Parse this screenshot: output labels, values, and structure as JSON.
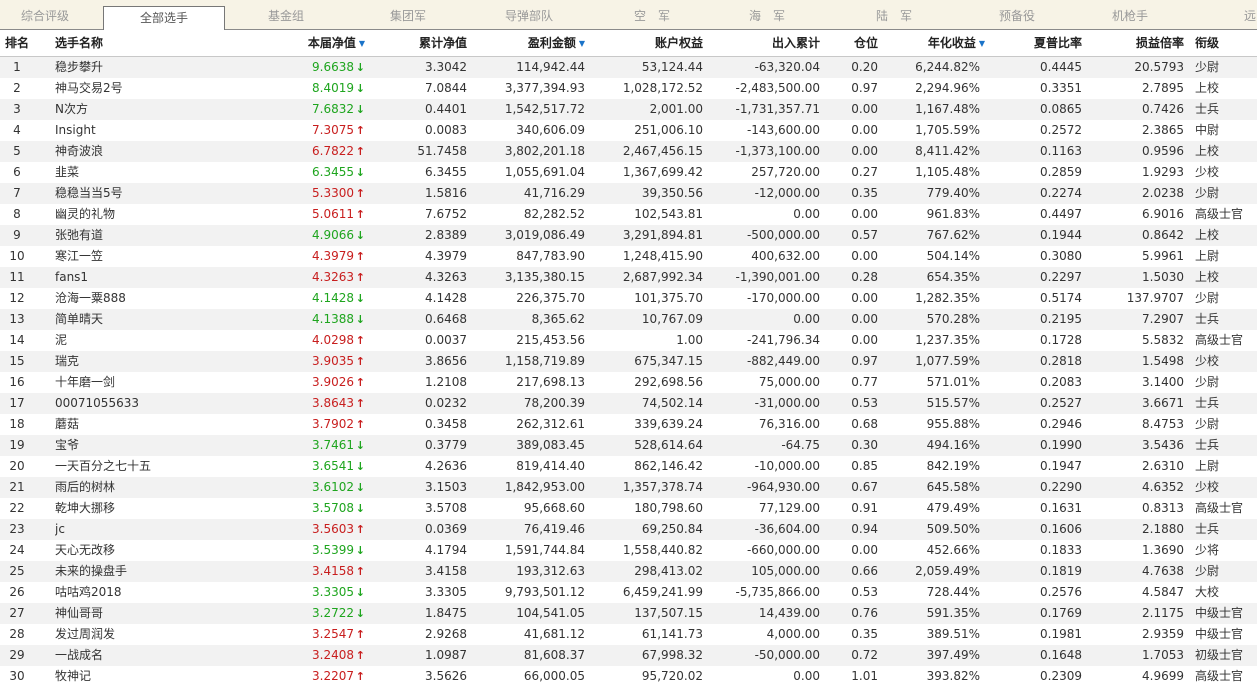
{
  "tabs": [
    "综合评级",
    "全部选手",
    "基金组",
    "集团军",
    "导弹部队",
    "空　军",
    "海　军",
    "陆　军",
    "预备役",
    "机枪手",
    "远"
  ],
  "active_tab": 1,
  "colors": {
    "up": "#c81e1e",
    "down": "#1ea51e",
    "sort_arrow": "#1a73c8"
  },
  "columns": [
    {
      "label": "排名",
      "sort": false
    },
    {
      "label": "选手名称",
      "sort": false
    },
    {
      "label": "本届净值",
      "sort": true
    },
    {
      "label": "累计净值",
      "sort": false
    },
    {
      "label": "盈利金额",
      "sort": true
    },
    {
      "label": "账户权益",
      "sort": false
    },
    {
      "label": "出入累计",
      "sort": false
    },
    {
      "label": "仓位",
      "sort": false
    },
    {
      "label": "年化收益",
      "sort": true
    },
    {
      "label": "夏普比率",
      "sort": false
    },
    {
      "label": "损益倍率",
      "sort": false
    },
    {
      "label": "衔级",
      "sort": false
    }
  ],
  "rows": [
    [
      "1",
      "稳步攀升",
      "9.6638",
      "down",
      "3.3042",
      "114,942.44",
      "53,124.44",
      "-63,320.04",
      "0.20",
      "6,244.82%",
      "0.4445",
      "20.5793",
      "少尉"
    ],
    [
      "2",
      "神马交易2号",
      "8.4019",
      "down",
      "7.0844",
      "3,377,394.93",
      "1,028,172.52",
      "-2,483,500.00",
      "0.97",
      "2,294.96%",
      "0.3351",
      "2.7895",
      "上校"
    ],
    [
      "3",
      "N次方",
      "7.6832",
      "down",
      "0.4401",
      "1,542,517.72",
      "2,001.00",
      "-1,731,357.71",
      "0.00",
      "1,167.48%",
      "0.0865",
      "0.7426",
      "士兵"
    ],
    [
      "4",
      "Insight",
      "7.3075",
      "up",
      "0.0083",
      "340,606.09",
      "251,006.10",
      "-143,600.00",
      "0.00",
      "1,705.59%",
      "0.2572",
      "2.3865",
      "中尉"
    ],
    [
      "5",
      "神奇波浪",
      "6.7822",
      "up",
      "51.7458",
      "3,802,201.18",
      "2,467,456.15",
      "-1,373,100.00",
      "0.00",
      "8,411.42%",
      "0.1163",
      "0.9596",
      "上校"
    ],
    [
      "6",
      "韭菜",
      "6.3455",
      "down",
      "6.3455",
      "1,055,691.04",
      "1,367,699.42",
      "257,720.00",
      "0.27",
      "1,105.48%",
      "0.2859",
      "1.9293",
      "少校"
    ],
    [
      "7",
      "稳稳当当5号",
      "5.3300",
      "up",
      "1.5816",
      "41,716.29",
      "39,350.56",
      "-12,000.00",
      "0.35",
      "779.40%",
      "0.2274",
      "2.0238",
      "少尉"
    ],
    [
      "8",
      "幽灵的礼物",
      "5.0611",
      "up",
      "7.6752",
      "82,282.52",
      "102,543.81",
      "0.00",
      "0.00",
      "961.83%",
      "0.4497",
      "6.9016",
      "高级士官"
    ],
    [
      "9",
      "张弛有道",
      "4.9066",
      "down",
      "2.8389",
      "3,019,086.49",
      "3,291,894.81",
      "-500,000.00",
      "0.57",
      "767.62%",
      "0.1944",
      "0.8642",
      "上校"
    ],
    [
      "10",
      "寒江一笠",
      "4.3979",
      "up",
      "4.3979",
      "847,783.90",
      "1,248,415.90",
      "400,632.00",
      "0.00",
      "504.14%",
      "0.3080",
      "5.9961",
      "上尉"
    ],
    [
      "11",
      "fans1",
      "4.3263",
      "up",
      "4.3263",
      "3,135,380.15",
      "2,687,992.34",
      "-1,390,001.00",
      "0.28",
      "654.35%",
      "0.2297",
      "1.5030",
      "上校"
    ],
    [
      "12",
      "沧海一粟888",
      "4.1428",
      "down",
      "4.1428",
      "226,375.70",
      "101,375.70",
      "-170,000.00",
      "0.00",
      "1,282.35%",
      "0.5174",
      "137.9707",
      "少尉"
    ],
    [
      "13",
      "简单晴天",
      "4.1388",
      "down",
      "0.6468",
      "8,365.62",
      "10,767.09",
      "0.00",
      "0.00",
      "570.28%",
      "0.2195",
      "7.2907",
      "士兵"
    ],
    [
      "14",
      "泥",
      "4.0298",
      "up",
      "0.0037",
      "215,453.56",
      "1.00",
      "-241,796.34",
      "0.00",
      "1,237.35%",
      "0.1728",
      "5.5832",
      "高级士官"
    ],
    [
      "15",
      "瑞克",
      "3.9035",
      "up",
      "3.8656",
      "1,158,719.89",
      "675,347.15",
      "-882,449.00",
      "0.97",
      "1,077.59%",
      "0.2818",
      "1.5498",
      "少校"
    ],
    [
      "16",
      "十年磨一剑",
      "3.9026",
      "up",
      "1.2108",
      "217,698.13",
      "292,698.56",
      "75,000.00",
      "0.77",
      "571.01%",
      "0.2083",
      "3.1400",
      "少尉"
    ],
    [
      "17",
      "00071055633",
      "3.8643",
      "up",
      "0.0232",
      "78,200.39",
      "74,502.14",
      "-31,000.00",
      "0.53",
      "515.57%",
      "0.2527",
      "3.6671",
      "士兵"
    ],
    [
      "18",
      "蘑菇",
      "3.7902",
      "up",
      "0.3458",
      "262,312.61",
      "339,639.24",
      "76,316.00",
      "0.68",
      "955.88%",
      "0.2946",
      "8.4753",
      "少尉"
    ],
    [
      "19",
      "宝爷",
      "3.7461",
      "down",
      "0.3779",
      "389,083.45",
      "528,614.64",
      "-64.75",
      "0.30",
      "494.16%",
      "0.1990",
      "3.5436",
      "士兵"
    ],
    [
      "20",
      "一天百分之七十五",
      "3.6541",
      "down",
      "4.2636",
      "819,414.40",
      "862,146.42",
      "-10,000.00",
      "0.85",
      "842.19%",
      "0.1947",
      "2.6310",
      "上尉"
    ],
    [
      "21",
      "雨后的树林",
      "3.6102",
      "down",
      "3.1503",
      "1,842,953.00",
      "1,357,378.74",
      "-964,930.00",
      "0.67",
      "645.58%",
      "0.2290",
      "4.6352",
      "少校"
    ],
    [
      "22",
      "乾坤大挪移",
      "3.5708",
      "down",
      "3.5708",
      "95,668.60",
      "180,798.60",
      "77,129.00",
      "0.91",
      "479.49%",
      "0.1631",
      "0.8313",
      "高级士官"
    ],
    [
      "23",
      "jc",
      "3.5603",
      "up",
      "0.0369",
      "76,419.46",
      "69,250.84",
      "-36,604.00",
      "0.94",
      "509.50%",
      "0.1606",
      "2.1880",
      "士兵"
    ],
    [
      "24",
      "天心无改移",
      "3.5399",
      "down",
      "4.1794",
      "1,591,744.84",
      "1,558,440.82",
      "-660,000.00",
      "0.00",
      "452.66%",
      "0.1833",
      "1.3690",
      "少将"
    ],
    [
      "25",
      "未来的操盘手",
      "3.4158",
      "up",
      "3.4158",
      "193,312.63",
      "298,413.02",
      "105,000.00",
      "0.66",
      "2,059.49%",
      "0.1819",
      "4.7638",
      "少尉"
    ],
    [
      "26",
      "咕咕鸡2018",
      "3.3305",
      "down",
      "3.3305",
      "9,793,501.12",
      "6,459,241.99",
      "-5,735,866.00",
      "0.53",
      "728.44%",
      "0.2576",
      "4.5847",
      "大校"
    ],
    [
      "27",
      "神仙哥哥",
      "3.2722",
      "down",
      "1.8475",
      "104,541.05",
      "137,507.15",
      "14,439.00",
      "0.76",
      "591.35%",
      "0.1769",
      "2.1175",
      "中级士官"
    ],
    [
      "28",
      "发过周润发",
      "3.2547",
      "up",
      "2.9268",
      "41,681.12",
      "61,141.73",
      "4,000.00",
      "0.35",
      "389.51%",
      "0.1981",
      "2.9359",
      "中级士官"
    ],
    [
      "29",
      "一战成名",
      "3.2408",
      "up",
      "1.0987",
      "81,608.37",
      "67,998.32",
      "-50,000.00",
      "0.72",
      "397.49%",
      "0.1648",
      "1.7053",
      "初级士官"
    ],
    [
      "30",
      "牧神记",
      "3.2207",
      "up",
      "3.5626",
      "66,000.05",
      "95,720.02",
      "0.00",
      "1.01",
      "393.82%",
      "0.2309",
      "4.9699",
      "高级士官"
    ]
  ]
}
